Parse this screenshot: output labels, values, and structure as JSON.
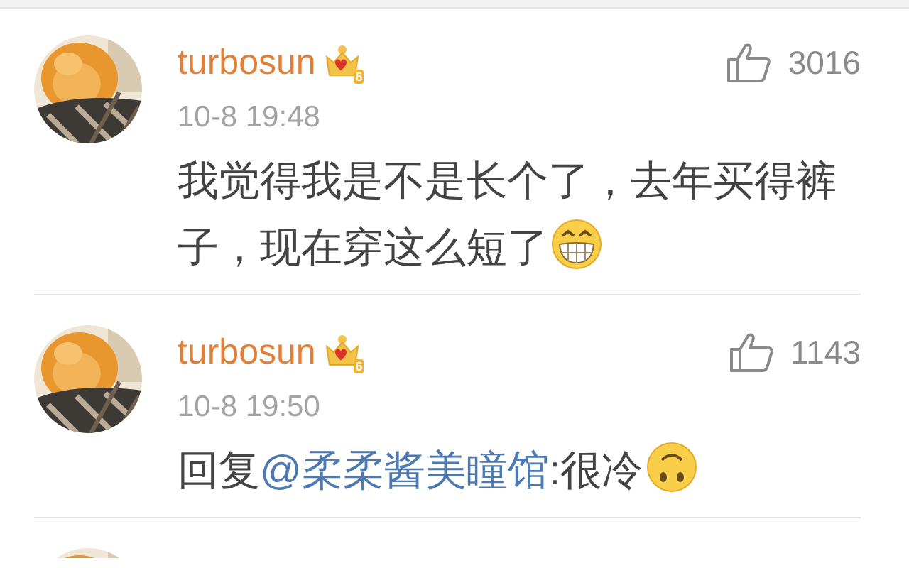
{
  "comments": [
    {
      "user": "turbosun",
      "badge": "6",
      "time": "10-8 19:48",
      "likes": "3016",
      "text": [
        {
          "kind": "plain",
          "text": "我觉得我是不是长个了，去年买得裤子，现在穿这么短了"
        }
      ],
      "emoji": {
        "kind": "grin"
      }
    },
    {
      "user": "turbosun",
      "badge": "6",
      "time": "10-8 19:50",
      "likes": "1143",
      "text": [
        {
          "kind": "plain",
          "text": "回复"
        },
        {
          "kind": "mention",
          "text": "@柔柔酱美瞳馆"
        },
        {
          "kind": "plain",
          "text": ":很冷"
        }
      ],
      "emoji": {
        "kind": "upside"
      }
    }
  ]
}
